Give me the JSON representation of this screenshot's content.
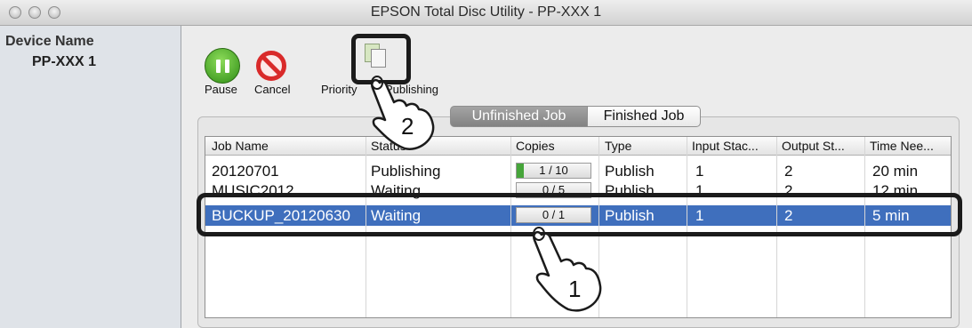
{
  "window": {
    "title": "EPSON Total Disc Utility - PP-XXX 1"
  },
  "sidebar": {
    "header": "Device Name",
    "items": [
      {
        "label": "PP-XXX 1"
      }
    ]
  },
  "toolbar": {
    "pause_label": "Pause",
    "cancel_label": "Cancel",
    "priority_label": "Priority",
    "publishing_label": "Publishing"
  },
  "tabs": [
    {
      "label": "Unfinished Job",
      "active": true
    },
    {
      "label": "Finished Job",
      "active": false
    }
  ],
  "table": {
    "headers": [
      "Job Name",
      "Status",
      "Copies",
      "Type",
      "Input Stac...",
      "Output St...",
      "Time Nee..."
    ],
    "rows": [
      {
        "job_name": "20120701",
        "status": "Publishing",
        "copies": "1 / 10",
        "progress": 0.1,
        "type": "Publish",
        "input": "1",
        "output": "2",
        "time": "20 min",
        "selected": false
      },
      {
        "job_name": "MUSIC2012",
        "status": "Waiting",
        "copies": "0 / 5",
        "progress": 0,
        "type": "Publish",
        "input": "1",
        "output": "2",
        "time": "12 min",
        "selected": false
      },
      {
        "job_name": "BUCKUP_20120630",
        "status": "Waiting",
        "copies": "0 / 1",
        "progress": 0,
        "type": "Publish",
        "input": "1",
        "output": "2",
        "time": "5 min",
        "selected": true
      }
    ]
  },
  "annotations": {
    "callout_1": "1",
    "callout_2": "2"
  },
  "colors": {
    "selection": "#3f6fbd",
    "progress": "#46a53a",
    "pause": "#3c9a1e",
    "cancel": "#d92a2a"
  }
}
